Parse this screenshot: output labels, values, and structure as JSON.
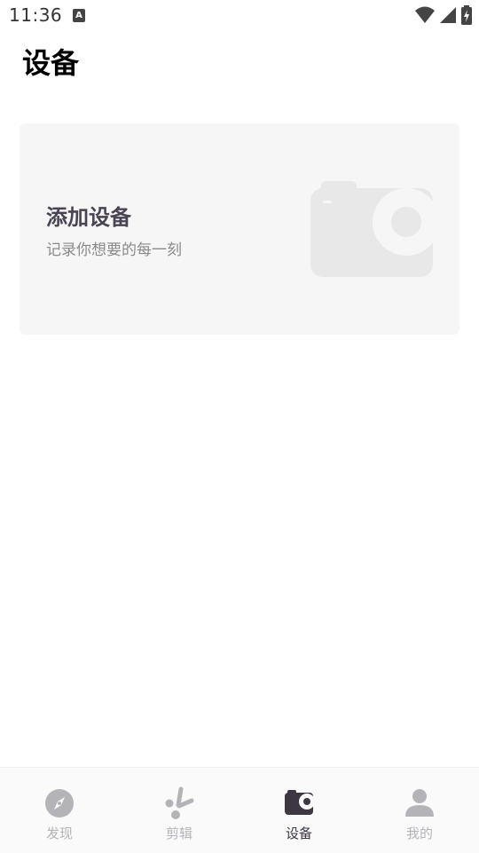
{
  "status_bar": {
    "time": "11:36",
    "notification_icon": "a-notification-icon"
  },
  "page": {
    "title": "设备"
  },
  "card": {
    "title": "添加设备",
    "subtitle": "记录你想要的每一刻",
    "icon": "camera-icon"
  },
  "nav": {
    "items": [
      {
        "label": "发现",
        "icon": "compass-icon",
        "active": false
      },
      {
        "label": "剪辑",
        "icon": "scissors-icon",
        "active": false
      },
      {
        "label": "设备",
        "icon": "camera-icon",
        "active": true
      },
      {
        "label": "我的",
        "icon": "person-icon",
        "active": false
      }
    ]
  },
  "colors": {
    "active": "#3d3744",
    "inactive": "#b4b4b8",
    "card_bg": "#f6f6f6",
    "card_title": "#4a4452",
    "card_subtitle": "#8a8a8a"
  }
}
